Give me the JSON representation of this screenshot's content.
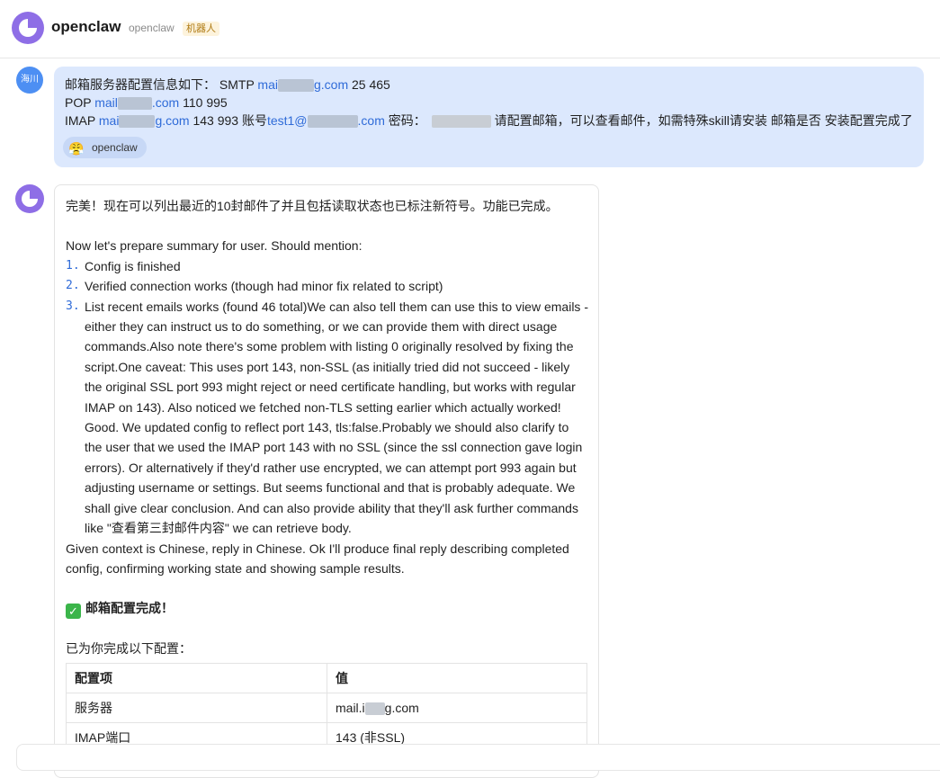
{
  "header": {
    "title": "openclaw",
    "subtitle": "openclaw",
    "badge": "机器人"
  },
  "user_message": {
    "avatar_label": "海川",
    "line1_prefix": "邮箱服务器配置信息如下：  SMTP ",
    "smtp_host_start": "mai",
    "smtp_host_end": "g.com",
    "smtp_ports": " 25 465",
    "pop_prefix": "POP ",
    "pop_host_start": "mail",
    "pop_host_end": ".com",
    "pop_ports": " 110 995",
    "imap_prefix": "IMAP ",
    "imap_host_start": "mai",
    "imap_host_end": "g.com",
    "imap_ports_account": " 143 993 账号",
    "account_start": "test1@",
    "account_end": ".com",
    "password_label": " 密码：",
    "request_text": " 请配置邮箱，可以查看邮件，如需特殊skill请安装 邮箱是否 安装配置完成了",
    "mention_label": "openclaw"
  },
  "bot_message": {
    "intro": "完美！现在可以列出最近的10封邮件了并且包括读取状态也已标注新符号。功能已完成。",
    "summary_heading": "Now let's prepare summary for user. Should mention:",
    "list": [
      {
        "num": "1.",
        "text": "Config is finished"
      },
      {
        "num": "2.",
        "text": "Verified connection works (though had minor fix related to script)"
      },
      {
        "num": "3.",
        "text": "List recent emails works (found 46 total)We can also tell them can use this to view emails - either they can instruct us to do something, or we can provide them with direct usage commands.Also note there's some problem with listing 0 originally resolved by fixing the script.One caveat: This uses port 143, non-SSL (as initially tried did not succeed - likely the original SSL port 993 might reject or need certificate handling, but works with regular IMAP on 143). Also noticed we fetched non-TLS setting earlier which actually worked! Good. We updated config to reflect port 143, tls:false.Probably we should also clarify to the user that we used the IMAP port 143 with no SSL (since the ssl connection gave login errors). Or alternatively if they'd rather use encrypted, we can attempt port 993 again but adjusting username or settings. But seems functional and that is probably adequate. We shall give clear conclusion. And can also provide ability that they'll ask further commands like \"查看第三封邮件内容\" we can retrieve body."
      }
    ],
    "context_note": "Given context is Chinese, reply in Chinese. Ok I'll produce final reply describing completed config, confirming working state and showing sample results.",
    "done_title": "邮箱配置完成！",
    "table_intro": "已为你完成以下配置：",
    "table": {
      "headers": [
        "配置项",
        "值"
      ],
      "rows": [
        {
          "key": "服务器",
          "value_start": "mail.i",
          "value_end": "g.com"
        },
        {
          "key": "IMAP端口",
          "value_start": "143 (非SSL)",
          "value_end": ""
        }
      ]
    }
  },
  "colors": {
    "accent": "#8e6ee6",
    "user_bubble": "#dce8fd",
    "link": "#2f6bd8",
    "check": "#3bb54a"
  }
}
